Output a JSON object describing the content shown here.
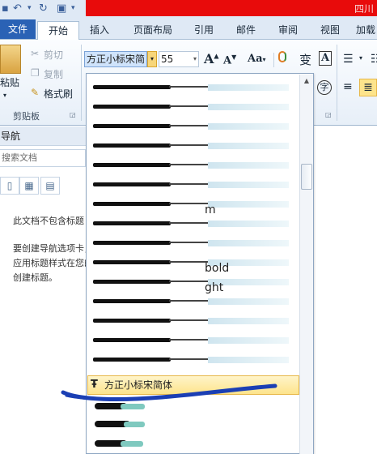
{
  "quick_access": {
    "undo_icon": "undo-icon",
    "redo_icon": "redo-icon",
    "save_icon": "save-icon",
    "doc_title": "四川"
  },
  "tabs": [
    {
      "label": "文件"
    },
    {
      "label": "开始"
    },
    {
      "label": "插入"
    },
    {
      "label": "页面布局"
    },
    {
      "label": "引用"
    },
    {
      "label": "邮件"
    },
    {
      "label": "审阅"
    },
    {
      "label": "视图"
    },
    {
      "label": "加载"
    }
  ],
  "ribbon": {
    "paste_label": "粘贴",
    "cut_label": "剪切",
    "copy_label": "复制",
    "format_painter_label": "格式刷",
    "clipboard_group": "剪贴板",
    "font_name": "方正小标宋简",
    "font_size": "55",
    "grow_font": "A",
    "shrink_font": "A",
    "change_case": "Aa",
    "phonetic": "变",
    "border_char": "A",
    "enclose_char": "字"
  },
  "nav": {
    "title": "导航",
    "search_placeholder": "搜索文档",
    "no_headings": "此文档不包含标题",
    "hint_line1": "要创建导航选项卡，请",
    "hint_line2": "应用标题样式在您的文档中",
    "hint_line3": "创建标题。"
  },
  "font_list": {
    "suffixes": [
      "m",
      "bold",
      "ght"
    ],
    "selected": "方正小标宋简体"
  }
}
